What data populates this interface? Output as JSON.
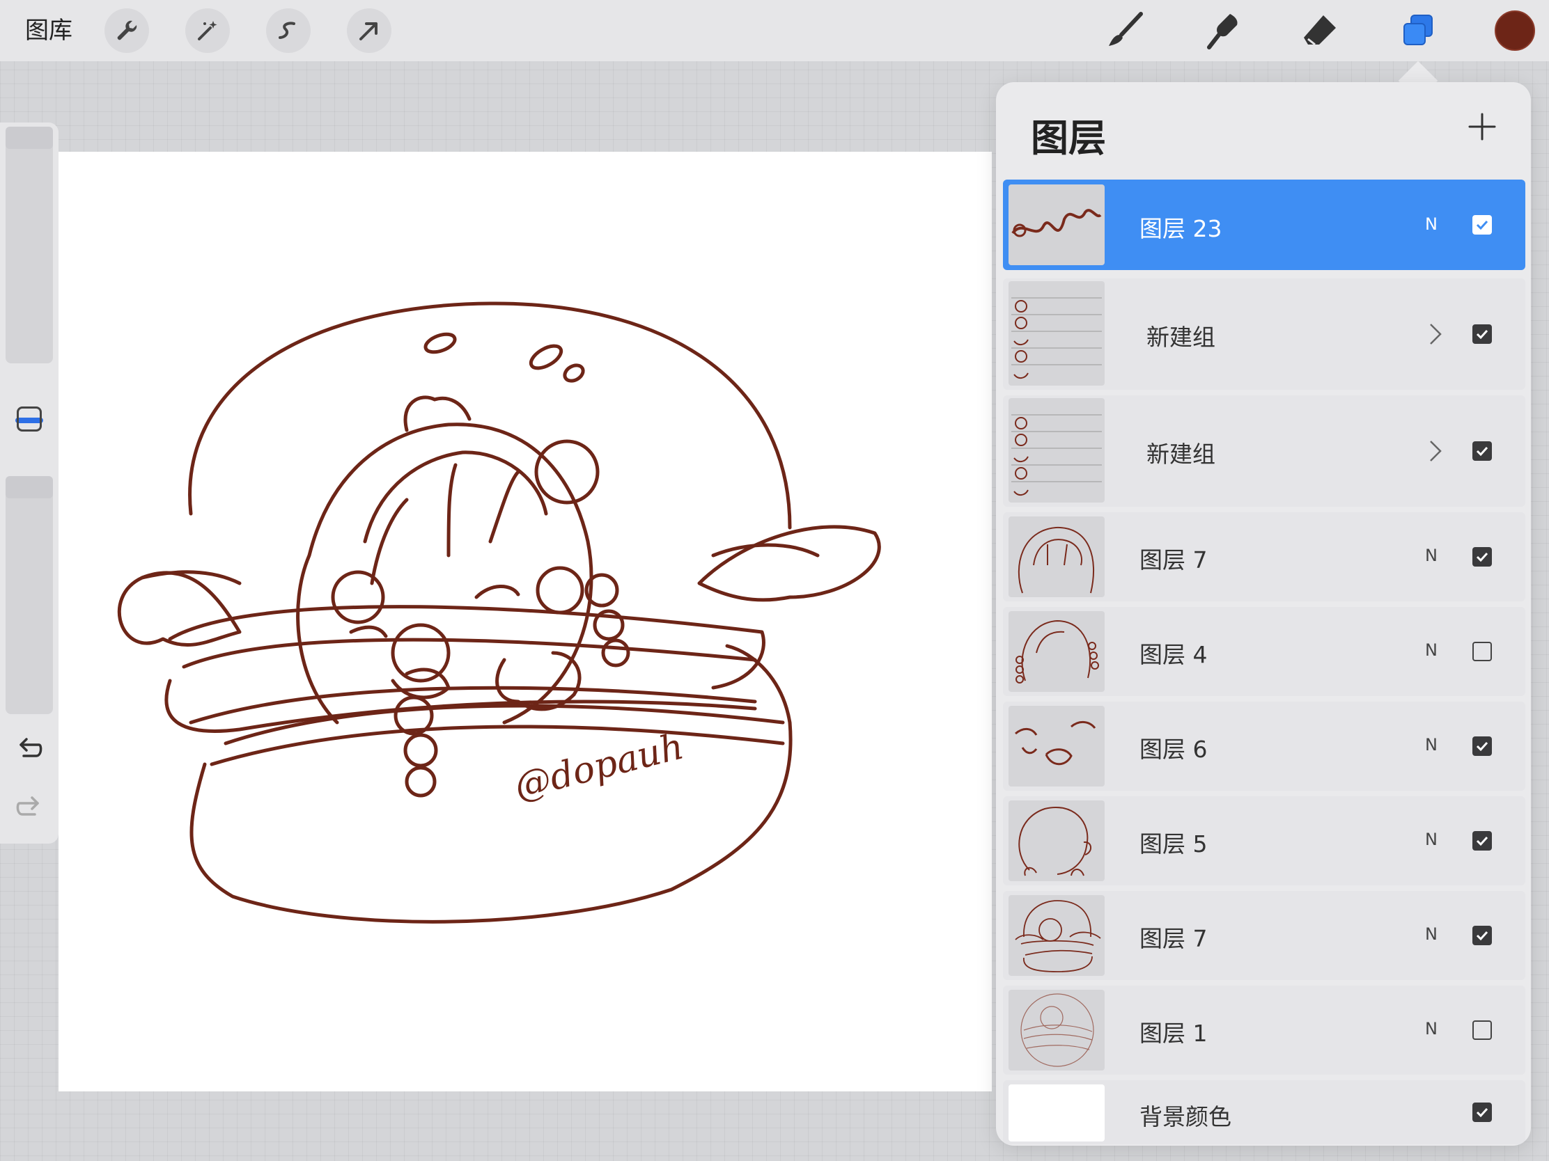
{
  "toolbar": {
    "gallery_label": "图库",
    "left_tools": [
      "wrench-icon",
      "magic-wand-icon",
      "selection-icon",
      "transform-arrow-icon"
    ],
    "right_tools": [
      "brush-icon",
      "smudge-icon",
      "eraser-icon",
      "layers-icon"
    ],
    "active_color": "#6d2517"
  },
  "sidebar": {
    "tools": [
      "brush-size-slider",
      "modify-button",
      "opacity-slider",
      "undo-icon",
      "redo-icon"
    ]
  },
  "canvas": {
    "signature_text": "@dopauh",
    "line_color": "#6d2517"
  },
  "layers_panel": {
    "title": "图层",
    "add_icon": "plus-icon",
    "accent": "#3f8ef3",
    "layers": [
      {
        "name": "图层 23",
        "mode": "N",
        "visible": true,
        "selected": true,
        "type": "layer"
      },
      {
        "name": "新建组",
        "mode": "",
        "visible": true,
        "selected": false,
        "type": "group"
      },
      {
        "name": "新建组",
        "mode": "",
        "visible": true,
        "selected": false,
        "type": "group"
      },
      {
        "name": "图层 7",
        "mode": "N",
        "visible": true,
        "selected": false,
        "type": "layer"
      },
      {
        "name": "图层 4",
        "mode": "N",
        "visible": false,
        "selected": false,
        "type": "layer"
      },
      {
        "name": "图层 6",
        "mode": "N",
        "visible": true,
        "selected": false,
        "type": "layer"
      },
      {
        "name": "图层 5",
        "mode": "N",
        "visible": true,
        "selected": false,
        "type": "layer"
      },
      {
        "name": "图层 7",
        "mode": "N",
        "visible": true,
        "selected": false,
        "type": "layer"
      },
      {
        "name": "图层 1",
        "mode": "N",
        "visible": false,
        "selected": false,
        "type": "layer"
      },
      {
        "name": "背景颜色",
        "mode": "",
        "visible": true,
        "selected": false,
        "type": "background"
      }
    ]
  }
}
